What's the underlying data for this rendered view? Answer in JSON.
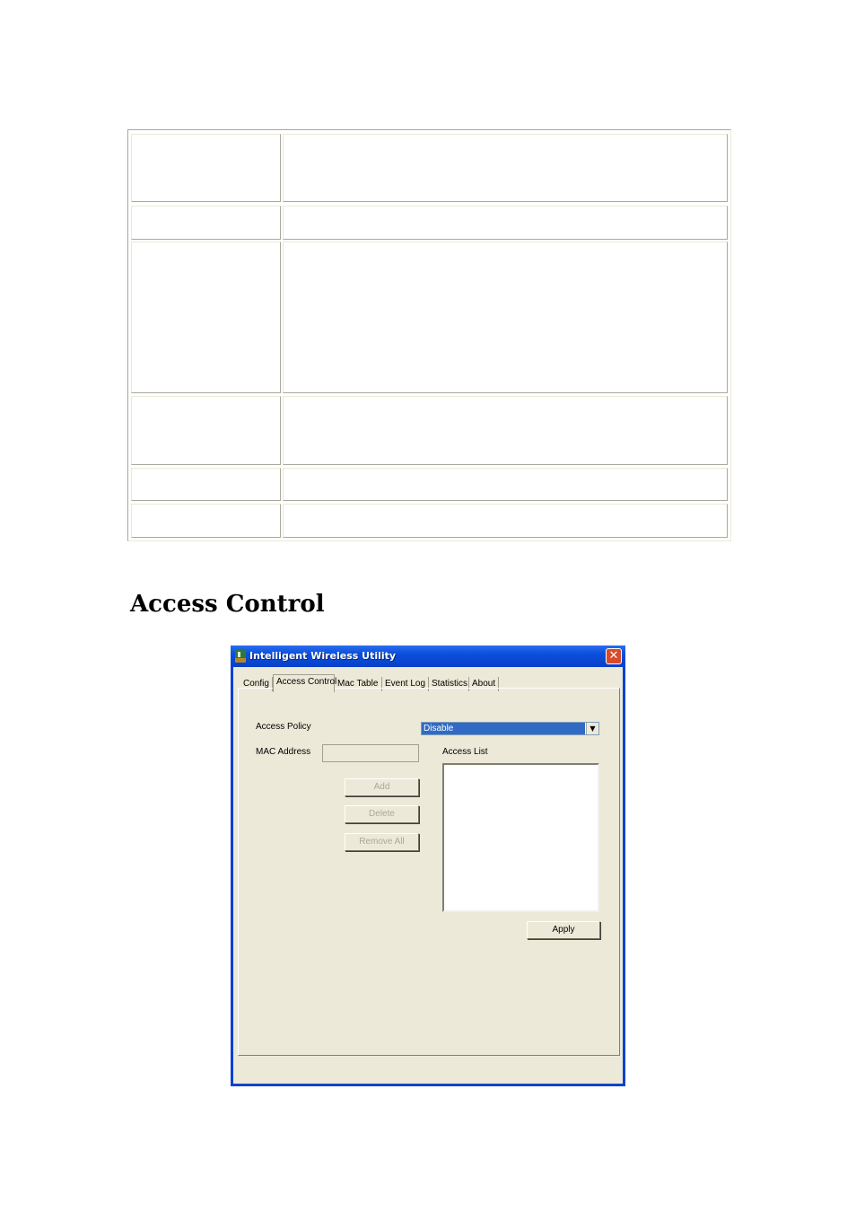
{
  "table": {
    "rows": [
      {
        "label": "",
        "value": ""
      },
      {
        "label": "",
        "value": ""
      },
      {
        "label": "",
        "value": ""
      },
      {
        "label": "",
        "value": ""
      },
      {
        "label": "",
        "value": ""
      },
      {
        "label": "",
        "value": ""
      }
    ]
  },
  "section_heading": "Access Control",
  "window": {
    "title": "Intelligent Wireless Utility",
    "close_glyph": "✕",
    "tabs": [
      {
        "label": "Config",
        "active": false
      },
      {
        "label": "Access Control",
        "active": true
      },
      {
        "label": "Mac Table",
        "active": false
      },
      {
        "label": "Event Log",
        "active": false
      },
      {
        "label": "Statistics",
        "active": false
      },
      {
        "label": "About",
        "active": false
      }
    ],
    "access_policy": {
      "label": "Access Policy",
      "selected": "Disable",
      "arrow_glyph": "▼"
    },
    "mac_address": {
      "label": "MAC Address",
      "value": ""
    },
    "access_list": {
      "label": "Access List",
      "items": []
    },
    "buttons": {
      "add": "Add",
      "delete": "Delete",
      "remove_all": "Remove All",
      "apply": "Apply"
    },
    "colors": {
      "titlebar": "#0a4fdb",
      "selection": "#316ac5",
      "face": "#ece9d8",
      "close": "#d84a2a"
    }
  }
}
